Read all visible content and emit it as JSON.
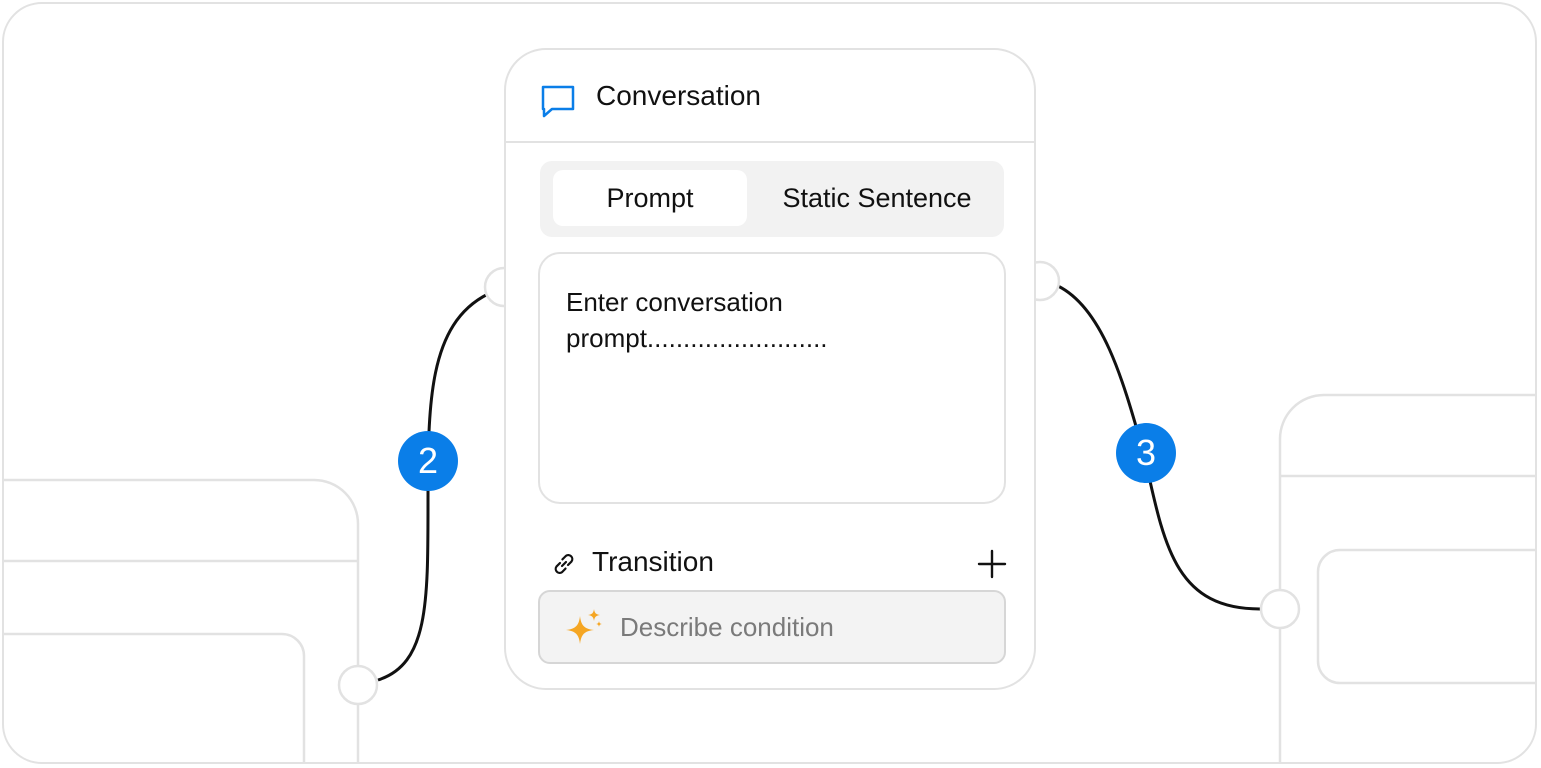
{
  "node": {
    "title": "Conversation",
    "icon": "chat-bubble-icon",
    "tabs": [
      {
        "label": "Prompt",
        "active": true
      },
      {
        "label": "Static Sentence",
        "active": false
      }
    ],
    "prompt_text": "Enter conversation prompt.........................",
    "transition": {
      "label": "Transition",
      "link_icon": "link-icon",
      "add_icon": "plus-icon",
      "condition_placeholder": "Describe condition",
      "condition_icon": "sparkle-icon"
    }
  },
  "edges": [
    {
      "badge": "2"
    },
    {
      "badge": "3"
    }
  ],
  "colors": {
    "accent": "#0a7ee8",
    "sparkle": "#f5a623",
    "border": "#e2e2e2"
  }
}
